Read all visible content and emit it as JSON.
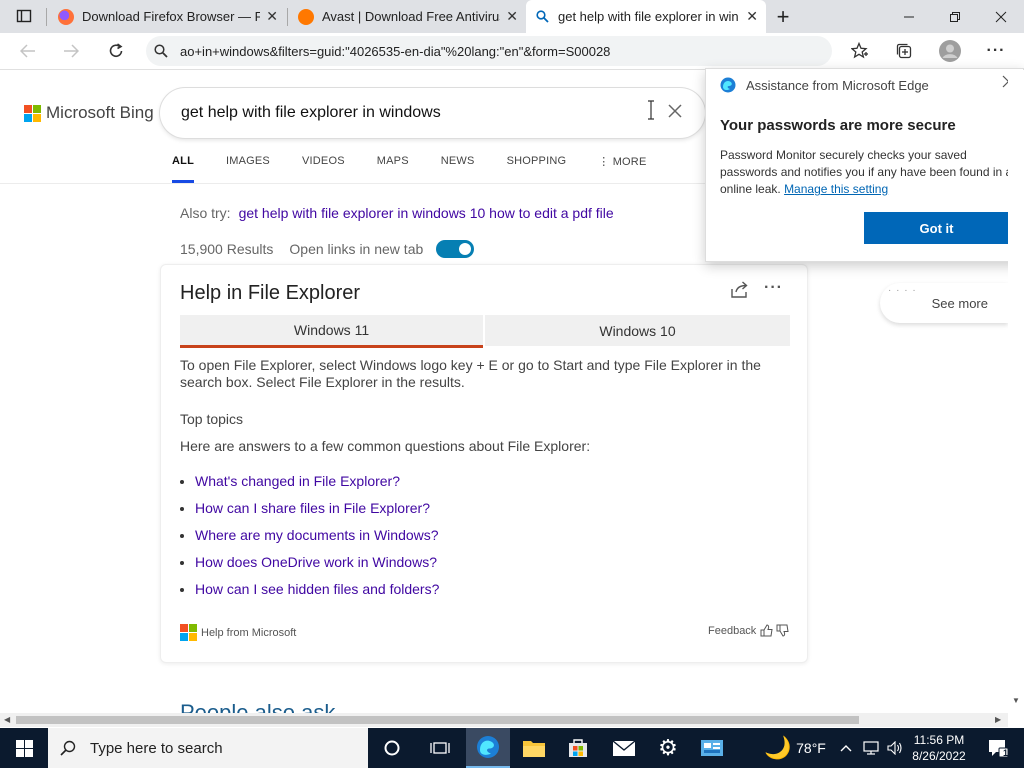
{
  "browser": {
    "tabs": [
      {
        "title": "Download Firefox Browser — Fas",
        "icon": "firefox-icon"
      },
      {
        "title": "Avast | Download Free Antivirus &",
        "icon": "avast-icon"
      },
      {
        "title": "get help with file explorer in win",
        "icon": "search-icon"
      }
    ],
    "url": "ao+in+windows&filters=guid:\"4026535-en-dia\"%20lang:\"en\"&form=S00028"
  },
  "bing": {
    "logo_text": "Microsoft Bing",
    "query": "get help with file explorer in windows",
    "nav": [
      "ALL",
      "IMAGES",
      "VIDEOS",
      "MAPS",
      "NEWS",
      "SHOPPING",
      "⋮ MORE"
    ],
    "also_try_label": "Also try:",
    "also_try_link": "get help with file explorer in windows 10 how to edit a pdf file",
    "results_count": "15,900 Results",
    "open_links_label": "Open links in new tab"
  },
  "card": {
    "title": "Help in File Explorer",
    "tabs": [
      "Windows 11",
      "Windows 10"
    ],
    "paragraph": "To open File Explorer, select Windows logo key + E or go to Start and type File Explorer in the search box. Select File Explorer in the results.",
    "top_topics": "Top topics",
    "intro": "Here are answers to a few common questions about File Explorer:",
    "links": [
      "What's changed in File Explorer?",
      "How can I share files in File Explorer?",
      "Where are my documents in Windows?",
      "How does OneDrive work in Windows?",
      "How can I see hidden files and folders?"
    ],
    "help_from": "Help from Microsoft",
    "feedback": "Feedback"
  },
  "people_also_ask": "People also ask",
  "see_more": "See more",
  "popup": {
    "header": "Assistance from Microsoft Edge",
    "title": "Your passwords are more secure",
    "body": "Password Monitor securely checks your saved passwords and notifies you if any have been found in an online leak.",
    "link": "Manage this setting",
    "button": "Got it"
  },
  "taskbar": {
    "search_placeholder": "Type here to search",
    "weather": "78°F",
    "time": "11:56 PM",
    "date": "8/26/2022",
    "notification_count": "1"
  },
  "colors": {
    "accent": "#0067b8",
    "link": "#4007a2",
    "tab_underline": "#c8431b"
  }
}
